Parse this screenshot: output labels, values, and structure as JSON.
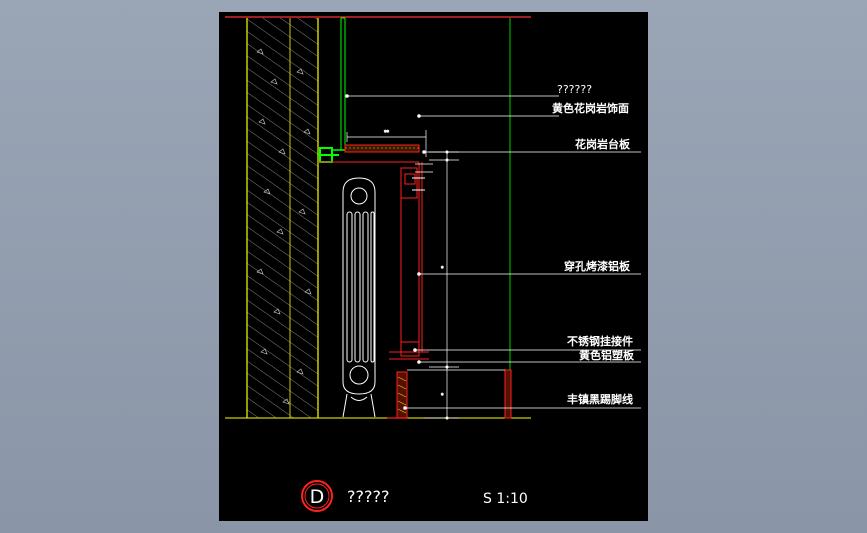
{
  "drawing": {
    "labels": {
      "unknown_top": "??????",
      "granite_facing": "黄色花岗岩饰面",
      "granite_sill": "花岗岩台板",
      "perforated_panel": "穿孔烤漆铝板",
      "ss_hanger": "不锈钢挂接件",
      "aluminum_plastic": "黄色铝塑板",
      "skirting": "丰镇黑踢脚线"
    },
    "title_block": {
      "symbol": "D",
      "title": "?????",
      "scale": "S 1:10"
    },
    "colors": {
      "background": "#000000",
      "wall_line": "#ffff00",
      "frame_red": "#ff0000",
      "green_line": "#00ff00",
      "dim_white": "#ffffff"
    }
  }
}
